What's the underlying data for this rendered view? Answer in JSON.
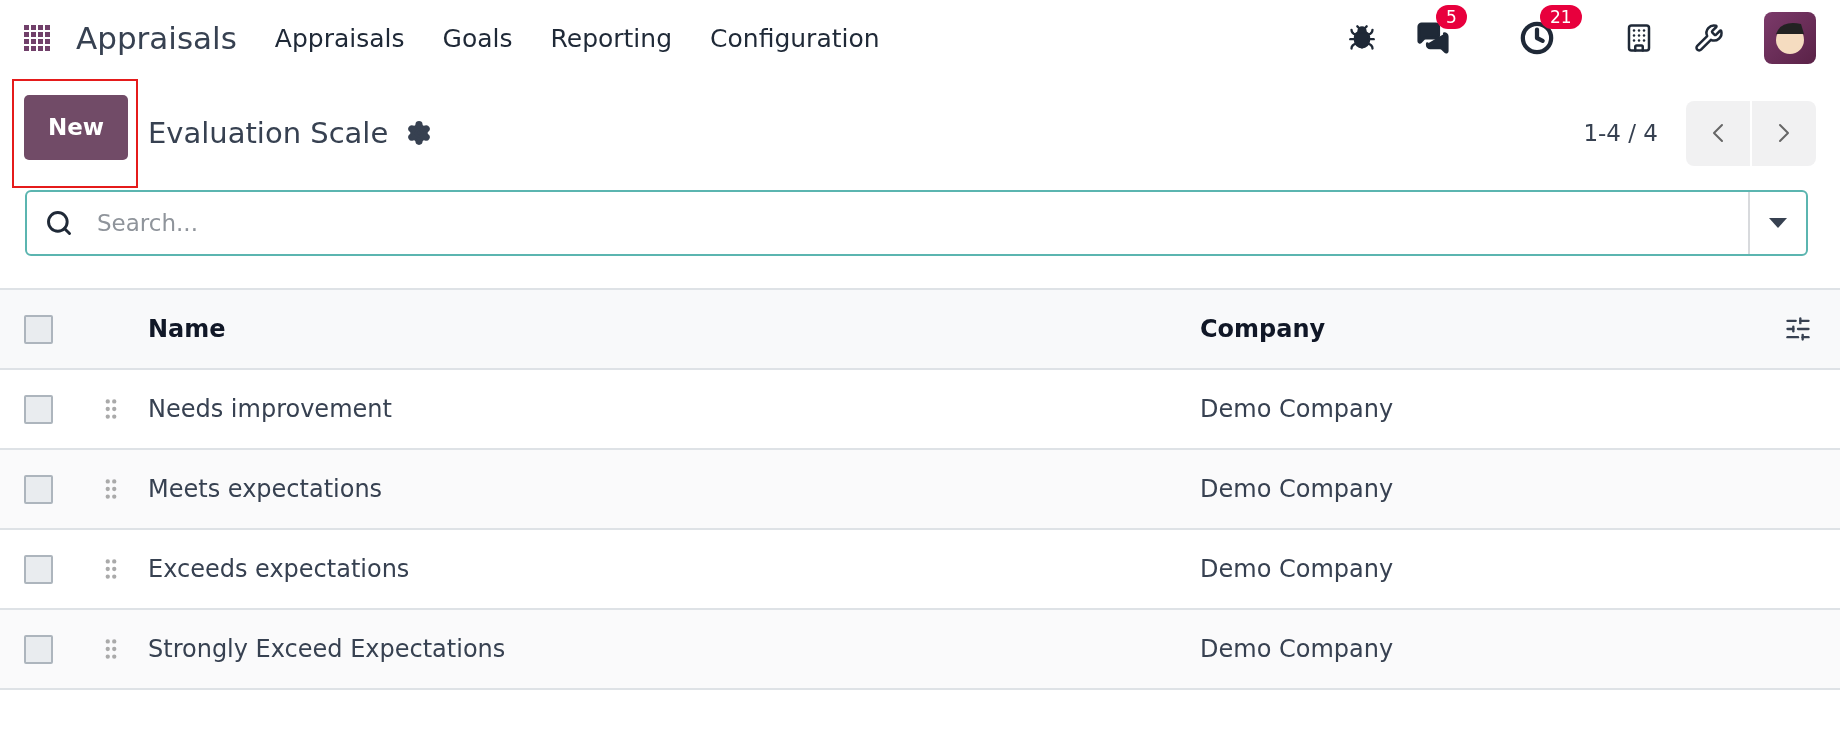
{
  "navbar": {
    "app_name": "Appraisals",
    "menu": [
      "Appraisals",
      "Goals",
      "Reporting",
      "Configuration"
    ],
    "messages_badge": "5",
    "activities_badge": "21"
  },
  "control_panel": {
    "new_button": "New",
    "title": "Evaluation Scale",
    "pager": "1-4 / 4"
  },
  "search": {
    "placeholder": "Search..."
  },
  "table": {
    "columns": [
      "Name",
      "Company"
    ],
    "select_all_checked": false,
    "rows": [
      {
        "name": "Needs improvement",
        "company": "Demo Company",
        "checked": false
      },
      {
        "name": "Meets expectations",
        "company": "Demo Company",
        "checked": false
      },
      {
        "name": "Exceeds expectations",
        "company": "Demo Company",
        "checked": false
      },
      {
        "name": "Strongly Exceed Expectations",
        "company": "Demo Company",
        "checked": false
      }
    ]
  }
}
